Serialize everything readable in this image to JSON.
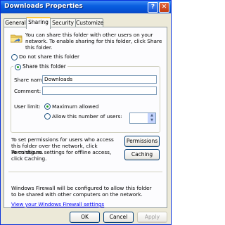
{
  "window": {
    "title": "Downloads Properties",
    "help_glyph": "?",
    "close_glyph": "✕"
  },
  "tabs": [
    {
      "label": "General"
    },
    {
      "label": "Sharing"
    },
    {
      "label": "Security"
    },
    {
      "label": "Customize"
    }
  ],
  "sharing": {
    "intro_text": "You can share this folder with other users on your network.  To enable sharing for this folder, click Share this folder.",
    "do_not_share_label": "Do not share this folder",
    "share_label": "Share this folder",
    "share_name_label": "Share name:",
    "share_name_value": "Downloads",
    "comment_label": "Comment:",
    "comment_value": "",
    "user_limit_label": "User limit:",
    "maximum_allowed_label": "Maximum allowed",
    "allow_users_label": "Allow this number of users:",
    "permissions_text": "To set permissions for users who access this folder over the network, click Permissions.",
    "permissions_button": "Permissions",
    "caching_text": "To configure settings for offline access, click Caching.",
    "caching_button": "Caching",
    "firewall_text": "Windows Firewall will be configured to allow this folder to be shared with other computers on the network.",
    "firewall_link": "View your Windows Firewall settings"
  },
  "footer": {
    "ok": "OK",
    "cancel": "Cancel",
    "apply": "Apply"
  }
}
